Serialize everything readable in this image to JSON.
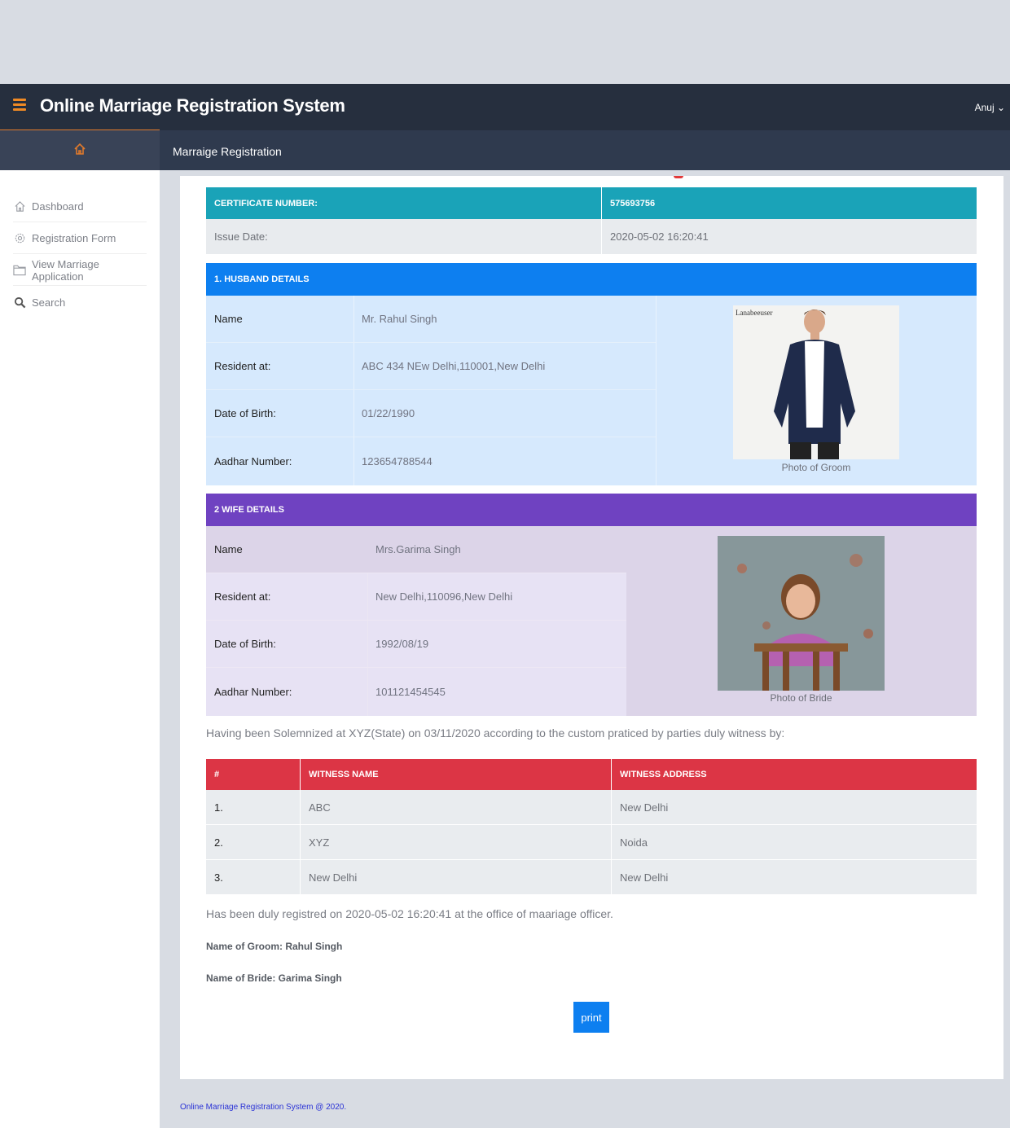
{
  "header": {
    "app_title": "Online Marriage Registration System",
    "user": "Anuj ⌄",
    "page_heading": "Marraige Registration"
  },
  "sidebar": {
    "items": [
      {
        "label": "Dashboard",
        "icon": "home-icon"
      },
      {
        "label": "Registration Form",
        "icon": "gear-icon"
      },
      {
        "label": "View Marriage Application",
        "icon": "folder-icon"
      },
      {
        "label": "Search",
        "icon": "search-icon"
      }
    ]
  },
  "certificate": {
    "number_label": "CERTIFICATE NUMBER:",
    "number": "575693756",
    "issue_label": "Issue Date:",
    "issue_date": "2020-05-02 16:20:41"
  },
  "husband": {
    "title": "1. HUSBAND DETAILS",
    "rows": [
      {
        "label": "Name",
        "value": "Mr. Rahul Singh"
      },
      {
        "label": "Resident at:",
        "value": "ABC 434 NEw Delhi,110001,New Delhi"
      },
      {
        "label": "Date of Birth:",
        "value": "01/22/1990"
      },
      {
        "label": "Aadhar Number:",
        "value": "123654788544"
      }
    ],
    "photo_caption": "Photo of Groom"
  },
  "wife": {
    "title": "2 WIFE DETAILS",
    "rows": [
      {
        "label": "Name",
        "value": "Mrs.Garima Singh"
      },
      {
        "label": "Resident at:",
        "value": "New Delhi,110096,New Delhi"
      },
      {
        "label": "Date of Birth:",
        "value": "1992/08/19"
      },
      {
        "label": "Aadhar Number:",
        "value": "101121454545"
      }
    ],
    "photo_caption": "Photo of Bride"
  },
  "solemnized_text": "Having been Solemnized at XYZ(State) on 03/11/2020 according to the custom praticed by parties duly witness by:",
  "witness_table": {
    "headers": [
      "#",
      "WITNESS NAME",
      "WITNESS ADDRESS"
    ],
    "rows": [
      [
        "1.",
        "ABC",
        "New Delhi"
      ],
      [
        "2.",
        "XYZ",
        "Noida"
      ],
      [
        "3.",
        "New Delhi",
        "New Delhi"
      ]
    ]
  },
  "registered_text": "Has been duly registred on 2020-05-02 16:20:41 at the office of maariage officer.",
  "groom_name": "Name of Groom: Rahul Singh",
  "bride_name": "Name of Bride: Garima Singh",
  "print_label": "print",
  "footer": "Online Marriage Registration System @ 2020.",
  "colors": {
    "topbar": "#262f3e",
    "accent": "#e07a2c",
    "certificate_header": "#1aa3b8",
    "husband_header": "#0d7ff0",
    "wife_header": "#6f42c1",
    "witness_header": "#dc3545",
    "print_button": "#0d7ff0"
  }
}
